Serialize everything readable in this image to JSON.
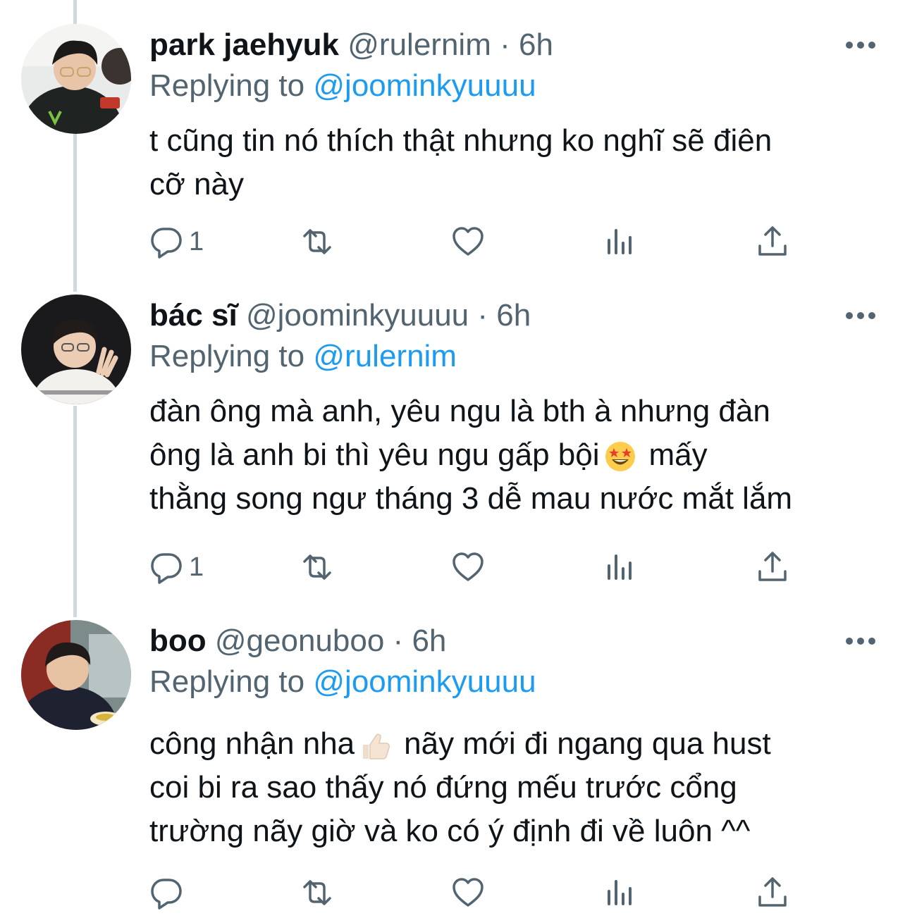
{
  "tweets": [
    {
      "name": "park jaehyuk",
      "handle": "@rulernim",
      "separator": "·",
      "time": "6h",
      "replying_prefix": "Replying to",
      "replying_to": "@joominkyuuuu",
      "text_lines": [
        "t cũng tin nó thích thật nhưng ko nghĩ sẽ điên",
        "cỡ này"
      ],
      "reply_count": "1",
      "icons": [
        "reply-icon",
        "retweet-icon",
        "like-icon",
        "analytics-icon",
        "share-icon",
        "more-icon"
      ]
    },
    {
      "name": "bác sĩ",
      "handle": "@joominkyuuuu",
      "separator": "·",
      "time": "6h",
      "replying_prefix": "Replying to",
      "replying_to": "@rulernim",
      "text_line1": "đàn ông mà anh, yêu ngu là bth à nhưng đàn",
      "text_line2_before": "ông là anh bi thì yêu ngu gấp bội",
      "text_line2_emoji": "star-struck-emoji",
      "text_line2_after": "mấy",
      "text_line3": "thằng song ngư tháng 3 dễ mau nước mắt lắm",
      "reply_count": "1"
    },
    {
      "name": "boo",
      "handle": "@geonuboo",
      "separator": "·",
      "time": "6h",
      "replying_prefix": "Replying to",
      "replying_to": "@joominkyuuuu",
      "text_line1_before": "công nhận nha",
      "text_line1_emoji": "thumbs-up-emoji",
      "text_line1_after": "nãy mới đi ngang qua hust",
      "text_line2": "coi bi ra sao thấy nó đứng mếu trước cổng",
      "text_line3": "trường nãy giờ và ko có ý định đi về luôn ^^",
      "reply_count": ""
    }
  ],
  "colors": {
    "text": "#0f1419",
    "secondary": "#536471",
    "link": "#1d9bf0",
    "thread_line": "#cfd9de"
  }
}
